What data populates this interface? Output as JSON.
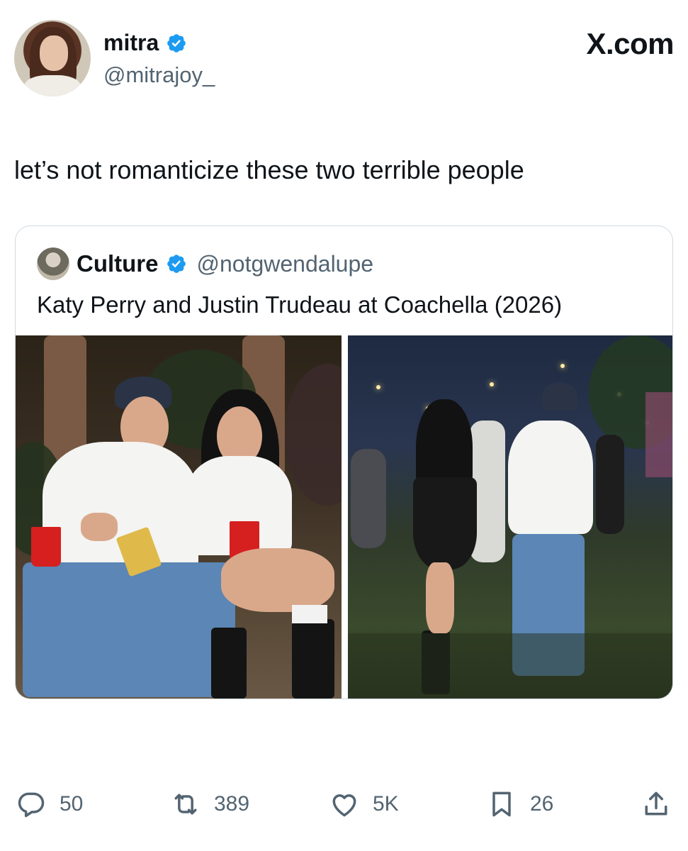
{
  "author": {
    "name": "mitra",
    "handle": "@mitrajoy_"
  },
  "brand": "X.com",
  "tweet": {
    "text": "let’s not romanticize these two terrible people"
  },
  "quoted": {
    "name": "Culture",
    "handle": "@notgwendalupe",
    "text": "Katy Perry and Justin Trudeau at Coachella (2026)"
  },
  "actions": {
    "replies": "50",
    "reposts": "389",
    "likes": "5K",
    "bookmarks": "26"
  },
  "icons": [
    "verified-badge-icon",
    "reply-icon",
    "repost-icon",
    "like-icon",
    "bookmark-icon",
    "share-icon"
  ],
  "colors": {
    "verified": "#1d9bf0",
    "muted": "#536471",
    "text": "#0f1419",
    "border": "#cfd9de"
  }
}
